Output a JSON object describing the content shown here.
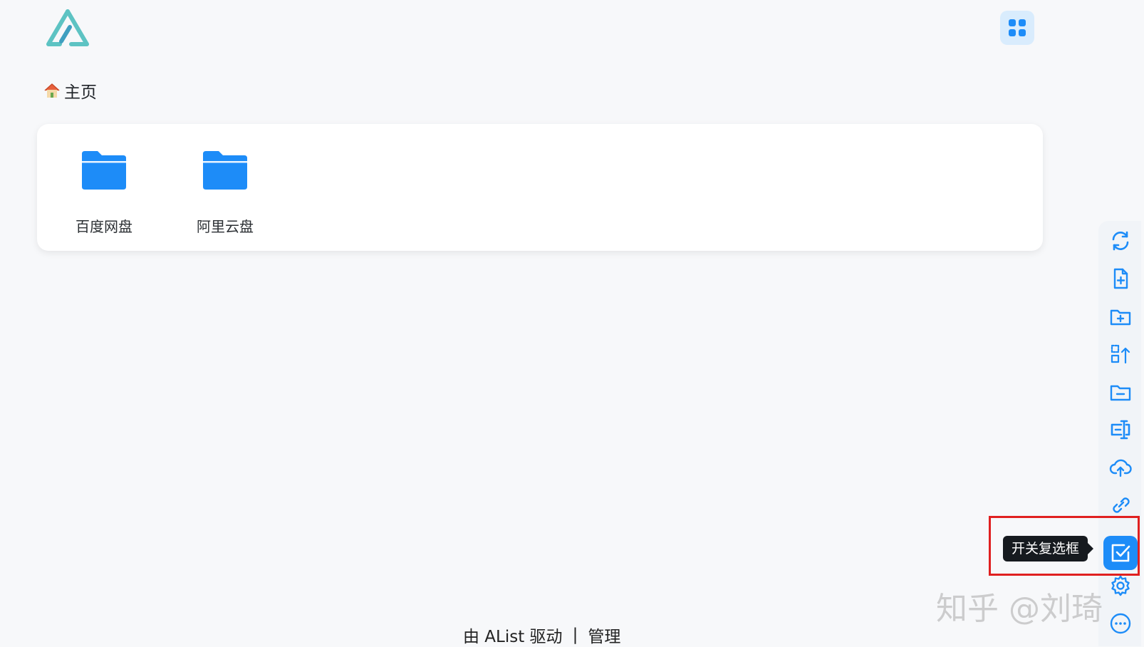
{
  "colors": {
    "accent": "#1d8cf8",
    "logo": "#5dc3c3",
    "highlight_box": "#e02020"
  },
  "breadcrumb": {
    "icon": "house-icon",
    "label": "主页"
  },
  "header": {
    "logo_icon": "alist-logo",
    "layout_button_icon": "grid-icon"
  },
  "folders": [
    {
      "name": "百度网盘",
      "icon": "folder-icon"
    },
    {
      "name": "阿里云盘",
      "icon": "folder-icon"
    }
  ],
  "toolbar": {
    "items": [
      {
        "icon": "refresh-icon"
      },
      {
        "icon": "new-file-icon"
      },
      {
        "icon": "new-folder-icon"
      },
      {
        "icon": "move-selection-icon"
      },
      {
        "icon": "folder-minus-icon"
      },
      {
        "icon": "rename-icon"
      },
      {
        "icon": "upload-icon"
      },
      {
        "icon": "link-icon"
      },
      {
        "icon": "checkbox-toggle-icon"
      },
      {
        "icon": "settings-icon"
      },
      {
        "icon": "more-icon"
      }
    ],
    "tooltip": "开关复选框"
  },
  "footer": {
    "powered_by": "由 AList 驱动",
    "separator": "|",
    "manage_label": "管理"
  },
  "watermark": "知乎 @刘琦"
}
